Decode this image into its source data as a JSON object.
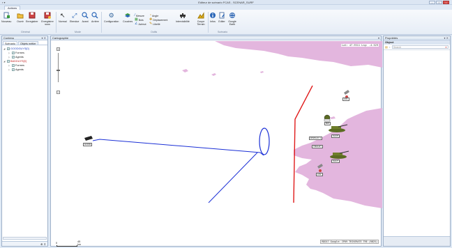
{
  "window": {
    "title": "Editeur de scénario FCAS - SCENAR_SURF",
    "qat": "▪ ▾"
  },
  "ribbon": {
    "tab": "Actions",
    "buttons": [
      {
        "label": "Nouveau",
        "icon": "new-icon"
      },
      {
        "label": "Ouvrir",
        "icon": "open-folder-icon"
      },
      {
        "label": "Enregistrer",
        "icon": "save-icon"
      },
      {
        "label": "Enregistrer sous",
        "icon": "save-as-icon"
      },
      {
        "label": "Normal",
        "icon": "cursor-icon"
      },
      {
        "label": "Etendue",
        "icon": "extent-icon"
      },
      {
        "label": "Avant",
        "icon": "zoom-in-icon"
      },
      {
        "label": "Arrière",
        "icon": "zoom-out-icon"
      },
      {
        "label": "Configuration",
        "icon": "configuration-icon"
      },
      {
        "label": "Couches",
        "icon": "layers-icon"
      },
      {
        "label": "Intervisibilité",
        "icon": "intervisibility-icon"
      },
      {
        "label": "Coupe Terrain",
        "icon": "terrain-cut-icon"
      },
      {
        "label": "Infos",
        "icon": "info-icon"
      },
      {
        "label": "Editer",
        "icon": "edit-icon"
      },
      {
        "label": "Google Earth",
        "icon": "google-earth-icon"
      }
    ],
    "small_buttons": [
      {
        "label": "Mesure",
        "icon": "ruler-icon"
      },
      {
        "label": "Bois",
        "icon": "forest-icon"
      },
      {
        "label": "Azimut",
        "icon": "azimuth-icon"
      },
      {
        "label": "Angle",
        "icon": "angle-icon"
      },
      {
        "label": "Déplacement",
        "icon": "move-icon"
      },
      {
        "label": "Libellé",
        "icon": "label-icon"
      }
    ],
    "groups": [
      "Général",
      "Mode",
      "Outils",
      "Scénario"
    ]
  },
  "left_panel": {
    "title": "Contenu",
    "tabs": [
      "Scénario",
      "Objets métier"
    ],
    "tree": [
      {
        "label": "GOODGUYS[0]",
        "color": "blue",
        "level": 0,
        "checked": true,
        "expanded": true
      },
      {
        "label": "Formes",
        "color": "black",
        "level": 1,
        "checked": true
      },
      {
        "label": "Agents",
        "color": "black",
        "level": 1,
        "checked": true
      },
      {
        "label": "BADGUYS[0]",
        "color": "red",
        "level": 0,
        "checked": true,
        "expanded": true
      },
      {
        "label": "Formes",
        "color": "black",
        "level": 1,
        "checked": true
      },
      {
        "label": "Agents",
        "color": "black",
        "level": 1,
        "checked": true
      }
    ],
    "footer_control": "⊕ ⇕"
  },
  "map": {
    "title": "Cartographie",
    "coord_readout": "Lat: 47.9311 Lng: -4.529",
    "status_readout": "RDD17 Google: IP09 TRIVERATE TRE (RB25)",
    "scale": {
      "start": "0",
      "end": "45",
      "unit": "km"
    },
    "units": [
      {
        "label": "GOOD",
        "color": "#111111"
      },
      {
        "label": "LR1",
        "color": "#111111"
      },
      {
        "label": "BW",
        "color": "#111111"
      },
      {
        "label": "SACP",
        "color": "#111111"
      },
      {
        "label": "DISPLAY 1",
        "color": "#111111"
      },
      {
        "label": "VIELLEY",
        "color": "#111111"
      },
      {
        "label": "SALP",
        "color": "#111111"
      },
      {
        "label": "LR2",
        "color": "#111111"
      }
    ],
    "colors": {
      "land": "#e3b6de",
      "blue_line": "#1a2fd6",
      "red_line": "#e01919",
      "tank": "#5b6b22"
    }
  },
  "right_panel": {
    "title": "Propriétés",
    "object_header": "Object",
    "search_placeholder": "Search"
  }
}
